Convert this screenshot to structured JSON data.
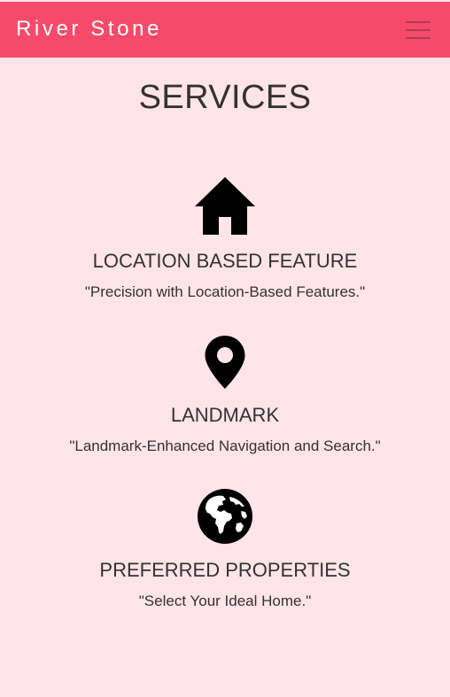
{
  "navbar": {
    "brand": "River Stone",
    "menu_icon": "hamburger-menu-icon"
  },
  "section": {
    "title": "SERVICES"
  },
  "services": [
    {
      "icon": "house-icon",
      "title": "LOCATION BASED FEATURE",
      "description": "\"Precision with Location-Based Features.\""
    },
    {
      "icon": "map-pin-icon",
      "title": "LANDMARK",
      "description": "\"Landmark-Enhanced Navigation and Search.\""
    },
    {
      "icon": "globe-americas-icon",
      "title": "PREFERRED PROPERTIES",
      "description": "\"Select Your Ideal Home.\""
    }
  ],
  "colors": {
    "navbar_bg": "#f54a6a",
    "page_bg": "#ffe4ea",
    "text": "#333333",
    "icon": "#000000"
  }
}
